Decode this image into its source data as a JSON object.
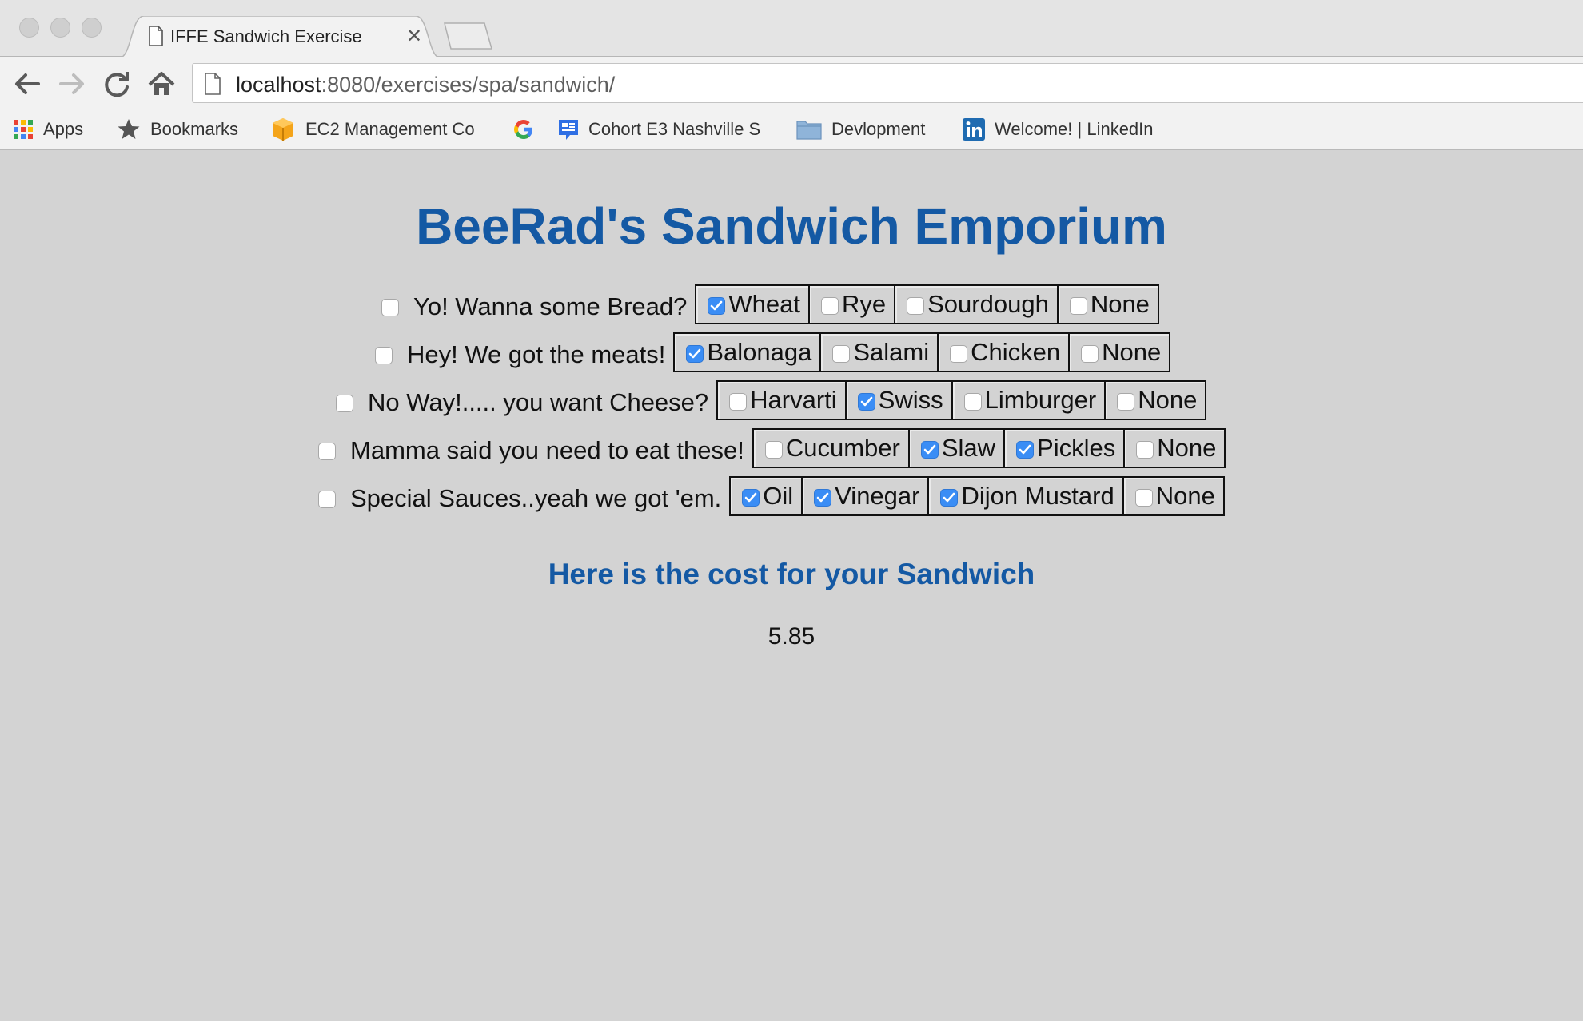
{
  "browser": {
    "tab_title": "IFFE Sandwich Exercise",
    "tab_close": "✕",
    "url_host": "localhost",
    "url_rest": ":8080/exercises/spa/sandwich/",
    "bookmarks": [
      {
        "label": "Apps",
        "icon": "apps-grid-icon"
      },
      {
        "label": "Bookmarks",
        "icon": "star-icon"
      },
      {
        "label": "EC2 Management Co",
        "icon": "aws-cube-icon"
      },
      {
        "label": "",
        "icon": "google-g-icon"
      },
      {
        "label": "Cohort E3 Nashville S",
        "icon": "slides-icon"
      },
      {
        "label": "Devlopment",
        "icon": "folder-icon"
      },
      {
        "label": "Welcome! | LinkedIn",
        "icon": "linkedin-icon"
      }
    ]
  },
  "page": {
    "title": "BeeRad's Sandwich Emporium",
    "rows": [
      {
        "label": "Yo! Wanna some Bread?",
        "checked": false,
        "options": [
          {
            "label": "Wheat",
            "checked": true
          },
          {
            "label": "Rye",
            "checked": false
          },
          {
            "label": "Sourdough",
            "checked": false
          },
          {
            "label": "None",
            "checked": false
          }
        ]
      },
      {
        "label": "Hey! We got the meats!",
        "checked": false,
        "options": [
          {
            "label": "Balonaga",
            "checked": true
          },
          {
            "label": "Salami",
            "checked": false
          },
          {
            "label": "Chicken",
            "checked": false
          },
          {
            "label": "None",
            "checked": false
          }
        ]
      },
      {
        "label": "No Way!..... you want Cheese?",
        "checked": false,
        "options": [
          {
            "label": "Harvarti",
            "checked": false
          },
          {
            "label": "Swiss",
            "checked": true
          },
          {
            "label": "Limburger",
            "checked": false
          },
          {
            "label": "None",
            "checked": false
          }
        ]
      },
      {
        "label": "Mamma said you need to eat these!",
        "checked": false,
        "options": [
          {
            "label": "Cucumber",
            "checked": false
          },
          {
            "label": "Slaw",
            "checked": true
          },
          {
            "label": "Pickles",
            "checked": true
          },
          {
            "label": "None",
            "checked": false
          }
        ]
      },
      {
        "label": "Special Sauces..yeah we got 'em.",
        "checked": false,
        "options": [
          {
            "label": "Oil",
            "checked": true
          },
          {
            "label": "Vinegar",
            "checked": true
          },
          {
            "label": "Dijon Mustard",
            "checked": true
          },
          {
            "label": "None",
            "checked": false
          }
        ]
      }
    ],
    "cost_title": "Here is the cost for your Sandwich",
    "cost_value": "5.85"
  },
  "colors": {
    "heading": "#1459a4",
    "page_bg": "#d3d3d3",
    "checkbox_on": "#3a8df5"
  }
}
